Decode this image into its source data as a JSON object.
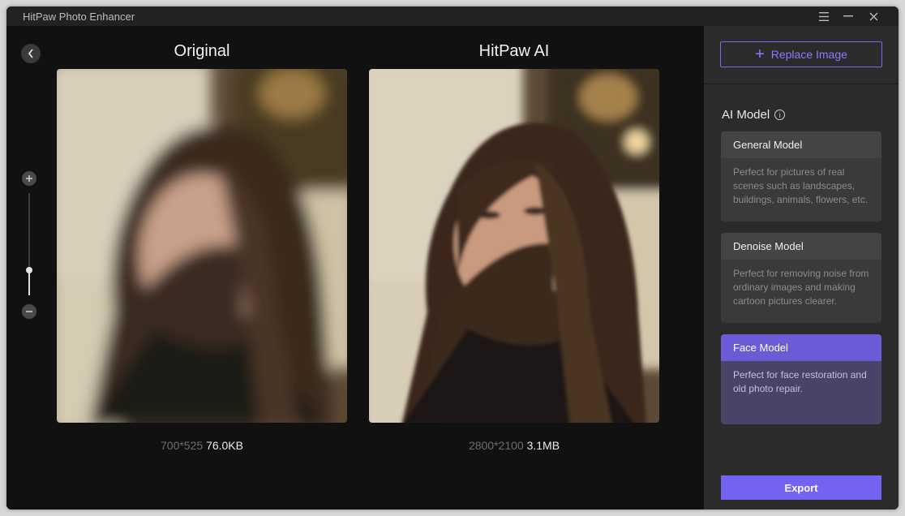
{
  "app": {
    "title": "HitPaw Photo Enhancer"
  },
  "preview": {
    "original": {
      "title": "Original",
      "dimensions": "700*525",
      "file_size": "76.0KB"
    },
    "enhanced": {
      "title": "HitPaw AI",
      "dimensions": "2800*2100",
      "file_size": "3.1MB"
    }
  },
  "zoom": {
    "level_fraction": 0.25
  },
  "sidebar": {
    "replace_label": "Replace Image",
    "model_heading": "AI Model",
    "models": [
      {
        "title": "General Model",
        "description": "Perfect for pictures of real scenes such as landscapes, buildings, animals, flowers, etc.",
        "selected": false
      },
      {
        "title": "Denoise Model",
        "description": "Perfect for removing noise from ordinary images and making cartoon pictures clearer.",
        "selected": false
      },
      {
        "title": "Face Model",
        "description": "Perfect for face restoration and old photo repair.",
        "selected": true
      }
    ],
    "export_label": "Export"
  },
  "colors": {
    "accent": "#7462f3",
    "accent_text": "#8b7bff",
    "background": "#111111",
    "sidebar": "#2b2b2b"
  }
}
